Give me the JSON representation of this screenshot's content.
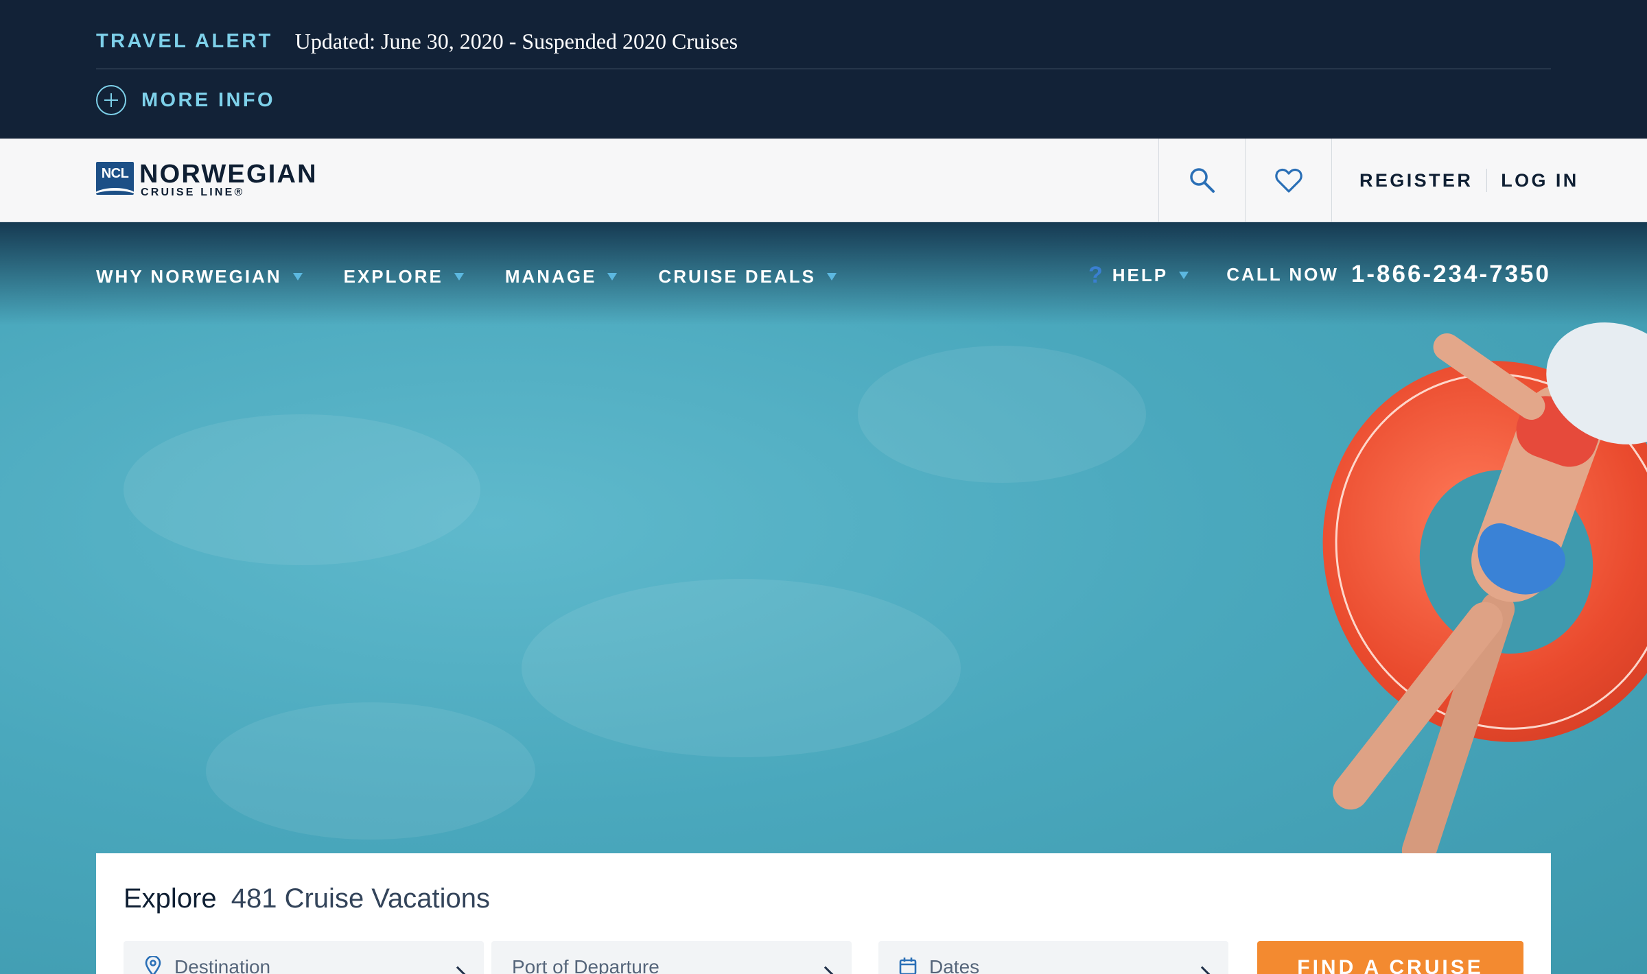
{
  "travel_alert": {
    "tag": "TRAVEL ALERT",
    "message": "Updated: June 30, 2020 - Suspended 2020 Cruises",
    "more_info_label": "MORE INFO"
  },
  "header": {
    "logo_mark": "NCL",
    "logo_name": "NORWEGIAN",
    "logo_sub": "CRUISE LINE®",
    "register_label": "REGISTER",
    "login_label": "LOG IN",
    "icons": [
      "search-icon",
      "heart-icon"
    ]
  },
  "nav": {
    "items": [
      {
        "label": "WHY NORWEGIAN"
      },
      {
        "label": "EXPLORE"
      },
      {
        "label": "MANAGE"
      },
      {
        "label": "CRUISE DEALS"
      }
    ],
    "help_label": "HELP",
    "call_label": "CALL NOW",
    "phone": "1-866-234-7350"
  },
  "search_panel": {
    "title_strong": "Explore",
    "title_count": "481 Cruise Vacations",
    "destination_label": "Destination",
    "port_label": "Port of Departure",
    "dates_label": "Dates",
    "find_button": "FIND A CRUISE"
  },
  "colors": {
    "alert_bg": "#122237",
    "alert_accent": "#7ed1ea",
    "header_bg": "#f7f7f8",
    "brand_navy": "#0f1f33",
    "water": "#4aa8bd",
    "cta_orange": "#f38a30",
    "caret_blue": "#5cb8e0"
  }
}
